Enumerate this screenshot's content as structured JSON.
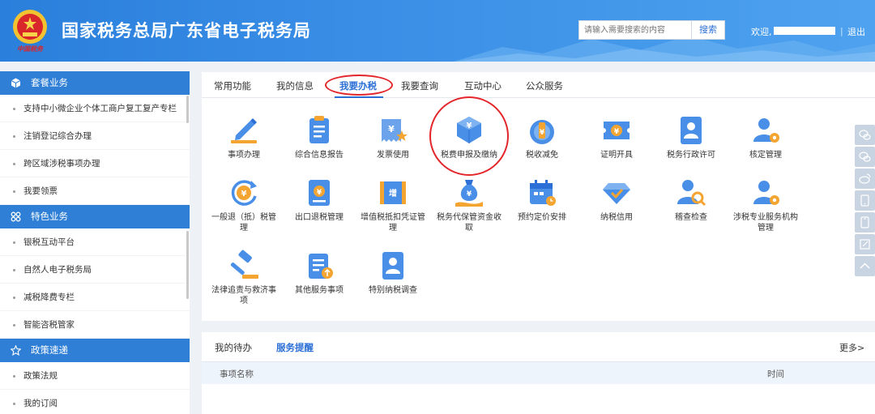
{
  "header": {
    "emblem_sub": "中国税务",
    "title": "国家税务总局广东省电子税务局",
    "search_placeholder": "请输入需要搜索的内容",
    "search_label": "搜索",
    "welcome": "欢迎,",
    "separator": "|",
    "logout": "退出"
  },
  "sidebar": {
    "sections": [
      {
        "title": "套餐业务",
        "icon": "cube-icon",
        "items": [
          "支持中小微企业个体工商户复工复产专栏",
          "注销登记综合办理",
          "跨区域涉税事项办理",
          "我要领票"
        ]
      },
      {
        "title": "特色业务",
        "icon": "grid-icon",
        "items": [
          "银税互动平台",
          "自然人电子税务局",
          "减税降费专栏",
          "智能咨税管家"
        ]
      },
      {
        "title": "政策速递",
        "icon": "star-icon",
        "items": [
          "政策法规",
          "我的订阅"
        ]
      }
    ]
  },
  "tabs": [
    "常用功能",
    "我的信息",
    "我要办税",
    "我要查询",
    "互动中心",
    "公众服务"
  ],
  "active_tab": "我要办税",
  "functions": [
    {
      "label": "事项办理",
      "icon": "pen-icon"
    },
    {
      "label": "综合信息报告",
      "icon": "report-icon"
    },
    {
      "label": "发票使用",
      "icon": "invoice-icon"
    },
    {
      "label": "税费申报及缴纳",
      "icon": "tax-declare-icon"
    },
    {
      "label": "税收减免",
      "icon": "tax-relief-icon"
    },
    {
      "label": "证明开具",
      "icon": "certificate-icon"
    },
    {
      "label": "税务行政许可",
      "icon": "license-icon"
    },
    {
      "label": "核定管理",
      "icon": "user-gear-icon"
    },
    {
      "label": "一般退（抵）税管理",
      "icon": "refund-icon"
    },
    {
      "label": "出口退税管理",
      "icon": "export-refund-icon"
    },
    {
      "label": "增值税抵扣凭证管理",
      "icon": "vat-voucher-icon"
    },
    {
      "label": "税务代保管资金收取",
      "icon": "money-bag-icon"
    },
    {
      "label": "预约定价安排",
      "icon": "calendar-icon"
    },
    {
      "label": "纳税信用",
      "icon": "diamond-icon"
    },
    {
      "label": "稽查检查",
      "icon": "inspect-icon"
    },
    {
      "label": "涉税专业服务机构管理",
      "icon": "agency-icon"
    },
    {
      "label": "法律追责与救济事项",
      "icon": "gavel-icon"
    },
    {
      "label": "其他服务事项",
      "icon": "other-service-icon"
    },
    {
      "label": "特别纳税调查",
      "icon": "special-survey-icon"
    }
  ],
  "bottom": {
    "tabs": [
      "我的待办",
      "服务提醒"
    ],
    "active_tab": "服务提醒",
    "more": "更多>",
    "columns": [
      "事项名称",
      "时间"
    ]
  },
  "colors": {
    "brand": "#2f7fd6",
    "highlight": "#e3262b"
  },
  "float_icons": [
    "chat-icon",
    "chat-icon",
    "weibo-icon",
    "phone-icon",
    "mobile-icon",
    "edit-icon",
    "up-arrow-icon"
  ]
}
